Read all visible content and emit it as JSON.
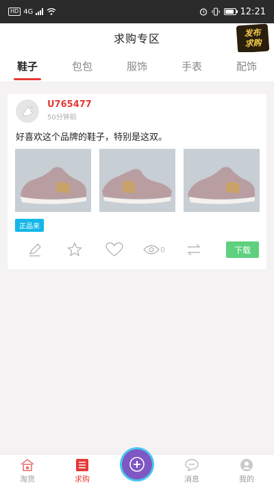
{
  "status_bar": {
    "left_indicators": [
      "HD",
      "4G"
    ],
    "time": "12:21",
    "icons": [
      "alarm-icon",
      "vibrate-icon",
      "battery-icon"
    ]
  },
  "header": {
    "title": "求购专区",
    "publish_badge_line1": "发布",
    "publish_badge_line2": "求购"
  },
  "tabs": [
    {
      "label": "鞋子",
      "active": true
    },
    {
      "label": "包包",
      "active": false
    },
    {
      "label": "服饰",
      "active": false
    },
    {
      "label": "手表",
      "active": false
    },
    {
      "label": "配饰",
      "active": false
    }
  ],
  "post": {
    "username": "U765477",
    "time": "50分钟前",
    "text": "好喜欢这个品牌的鞋子，特别是这双。",
    "tag": "正品来",
    "view_count": "0",
    "download_label": "下载",
    "photo_count": 3
  },
  "bottom_nav": [
    {
      "label": "淘货",
      "icon": "home-icon",
      "active": false
    },
    {
      "label": "求购",
      "icon": "list-icon",
      "active": true
    },
    {
      "label": "",
      "icon": "add-icon",
      "active": false
    },
    {
      "label": "消息",
      "icon": "message-icon",
      "active": false
    },
    {
      "label": "我的",
      "icon": "user-icon",
      "active": false
    }
  ],
  "colors": {
    "accent_red": "#e53935",
    "download_green": "#5fd07e",
    "tag_blue": "#15b7e8"
  }
}
